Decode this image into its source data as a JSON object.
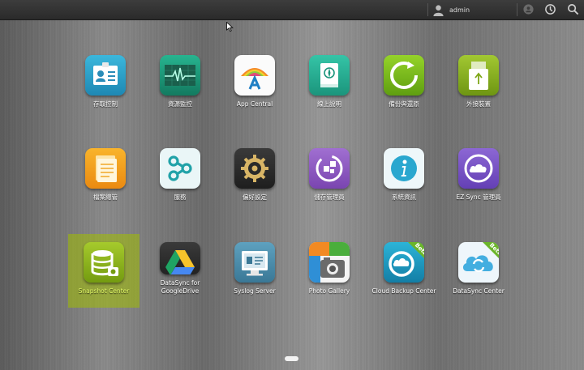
{
  "topbar": {
    "username": "admin",
    "icons": [
      "user-icon",
      "notification-icon",
      "settings-dial-icon",
      "search-icon"
    ]
  },
  "apps": [
    {
      "id": "access-control",
      "label": "存取控制",
      "icon": "id-card-icon",
      "color": "#29a3c9"
    },
    {
      "id": "resource-monitor",
      "label": "資源監控",
      "icon": "heartbeat-monitor-icon",
      "color": "#1d9a7a"
    },
    {
      "id": "app-central",
      "label": "App Central",
      "icon": "app-central-icon",
      "color": "#ffffff"
    },
    {
      "id": "online-help",
      "label": "線上說明",
      "icon": "help-book-icon",
      "color": "#2bb39a"
    },
    {
      "id": "backup-restore",
      "label": "備份與還原",
      "icon": "backup-restore-icon",
      "color": "#7bbf1a"
    },
    {
      "id": "external-devices",
      "label": "外接裝置",
      "icon": "usb-drive-icon",
      "color": "#8ab71d"
    },
    {
      "id": "file-explorer",
      "label": "檔案總管",
      "icon": "file-folder-icon",
      "color": "#f2a31c"
    },
    {
      "id": "services",
      "label": "服務",
      "icon": "services-share-icon",
      "color": "#eaf6f7"
    },
    {
      "id": "preferences",
      "label": "偏好設定",
      "icon": "gear-icon",
      "color": "#2e2e2e"
    },
    {
      "id": "storage-manager",
      "label": "儲存管理員",
      "icon": "storage-manager-icon",
      "color": "#8e5cc2"
    },
    {
      "id": "system-information",
      "label": "系統資訊",
      "icon": "info-icon",
      "color": "#e9f6fa"
    },
    {
      "id": "ez-sync-manager",
      "label": "EZ Sync 管理員",
      "icon": "ez-sync-cloud-icon",
      "color": "#7b57c8"
    },
    {
      "id": "snapshot-center",
      "label": "Snapshot Center",
      "icon": "snapshot-database-icon",
      "color": "#8fb31c",
      "selected": true
    },
    {
      "id": "datasync-googledrive",
      "label": "DataSync for GoogleDrive",
      "icon": "google-drive-icon",
      "color": "#2e2e2e"
    },
    {
      "id": "syslog-server",
      "label": "Syslog Server",
      "icon": "syslog-server-icon",
      "color": "#4a88a8"
    },
    {
      "id": "photo-gallery",
      "label": "Photo Gallery",
      "icon": "photo-gallery-camera-icon",
      "color": "#f5f5f5"
    },
    {
      "id": "cloud-backup-center",
      "label": "Cloud Backup Center",
      "icon": "cloud-backup-icon",
      "color": "#1c9fc2",
      "badge": "Beta"
    },
    {
      "id": "datasync-center",
      "label": "DataSync Center",
      "icon": "datasync-cloud-icon",
      "color": "#f0f6fb",
      "badge": "Beta"
    }
  ],
  "pager": {
    "pages": 1,
    "current": 1
  }
}
